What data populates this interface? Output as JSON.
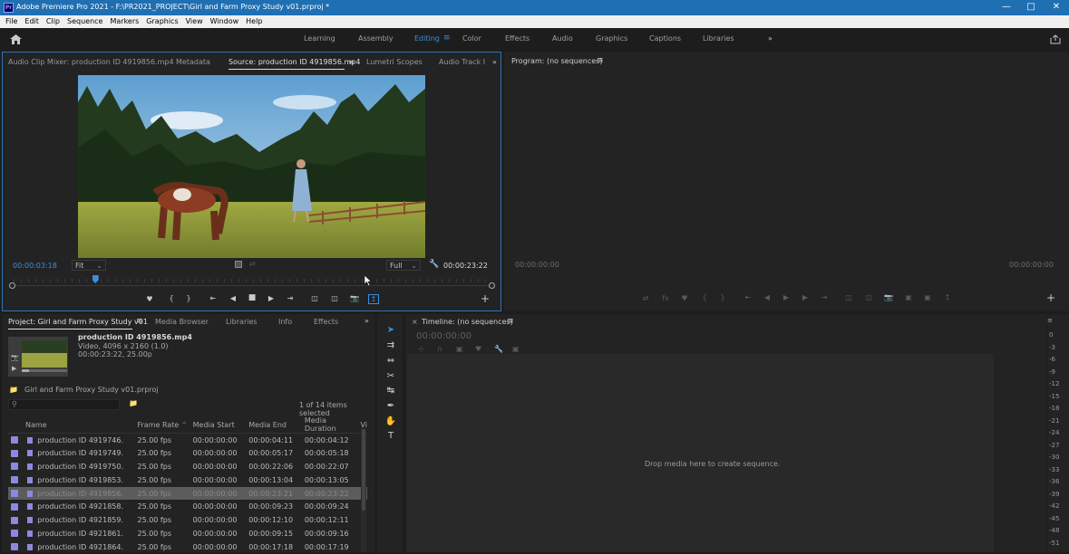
{
  "window": {
    "app_icon": "Pr",
    "title": "Adobe Premiere Pro 2021 - F:\\PR2021_PROJECT\\Girl and Farm Proxy Study v01.prproj *"
  },
  "menu": [
    "File",
    "Edit",
    "Clip",
    "Sequence",
    "Markers",
    "Graphics",
    "View",
    "Window",
    "Help"
  ],
  "workspaces": {
    "tabs": [
      "Learning",
      "Assembly",
      "Editing",
      "Color",
      "Effects",
      "Audio",
      "Graphics",
      "Captions",
      "Libraries"
    ],
    "active": "Editing",
    "overflow": "»"
  },
  "source_panel": {
    "tabs": [
      "Audio Clip Mixer: production ID 4919856.mp4",
      "Metadata",
      "Source: production ID 4919856.mp4",
      "Lumetri Scopes",
      "Audio Track I"
    ],
    "active_tab": "Source: production ID 4919856.mp4",
    "current_time": "00:00:03:18",
    "zoom": "Fit",
    "resolution": "Full",
    "duration": "00:00:23:22",
    "playhead_fraction": 0.17
  },
  "program_panel": {
    "title": "Program: (no sequences)",
    "current_time": "00:00:00:00",
    "duration": "00:00:00:00"
  },
  "project_panel": {
    "tabs": [
      "Project: Girl and Farm Proxy Study v01",
      "Media Browser",
      "Libraries",
      "Info",
      "Effects"
    ],
    "active_tab": "Project: Girl and Farm Proxy Study v01",
    "preview": {
      "name": "production ID 4919856.mp4",
      "line2": "Video, 4096 x 2160 (1.0)",
      "line3": "00:00:23:22, 25.00p"
    },
    "bin_path": "Girl and Farm Proxy Study v01.prproj",
    "selection_status": "1 of 14 items selected",
    "columns": [
      "Name",
      "Frame Rate",
      "Media Start",
      "Media End",
      "Media Duration",
      "Vi"
    ],
    "rows": [
      {
        "name": "production ID 4919746.",
        "fps": "25.00 fps",
        "start": "00:00:00:00",
        "end": "00:00:04:11",
        "dur": "00:00:04:12"
      },
      {
        "name": "production ID 4919749.",
        "fps": "25.00 fps",
        "start": "00:00:00:00",
        "end": "00:00:05:17",
        "dur": "00:00:05:18"
      },
      {
        "name": "production ID 4919750.",
        "fps": "25.00 fps",
        "start": "00:00:00:00",
        "end": "00:00:22:06",
        "dur": "00:00:22:07"
      },
      {
        "name": "production ID 4919853.",
        "fps": "25.00 fps",
        "start": "00:00:00:00",
        "end": "00:00:13:04",
        "dur": "00:00:13:05"
      },
      {
        "name": "production ID 4919856.",
        "fps": "25.00 fps",
        "start": "00:00:00:00",
        "end": "00:00:23:21",
        "dur": "00:00:23:22",
        "selected": true
      },
      {
        "name": "production ID 4921858.",
        "fps": "25.00 fps",
        "start": "00:00:00:00",
        "end": "00:00:09:23",
        "dur": "00:00:09:24"
      },
      {
        "name": "production ID 4921859.",
        "fps": "25.00 fps",
        "start": "00:00:00:00",
        "end": "00:00:12:10",
        "dur": "00:00:12:11"
      },
      {
        "name": "production ID 4921861.",
        "fps": "25.00 fps",
        "start": "00:00:00:00",
        "end": "00:00:09:15",
        "dur": "00:00:09:16"
      },
      {
        "name": "production ID 4921864.",
        "fps": "25.00 fps",
        "start": "00:00:00:00",
        "end": "00:00:17:18",
        "dur": "00:00:17:19"
      }
    ]
  },
  "timeline_panel": {
    "title": "Timeline: (no sequences)",
    "timecode": "00:00:00:00",
    "empty_message": "Drop media here to create sequence."
  },
  "audio_meter": {
    "ticks": [
      "0",
      "-3",
      "-6",
      "-9",
      "-12",
      "-15",
      "-18",
      "-21",
      "-24",
      "-27",
      "-30",
      "-33",
      "-36",
      "-39",
      "-42",
      "-45",
      "-48",
      "-51"
    ]
  }
}
